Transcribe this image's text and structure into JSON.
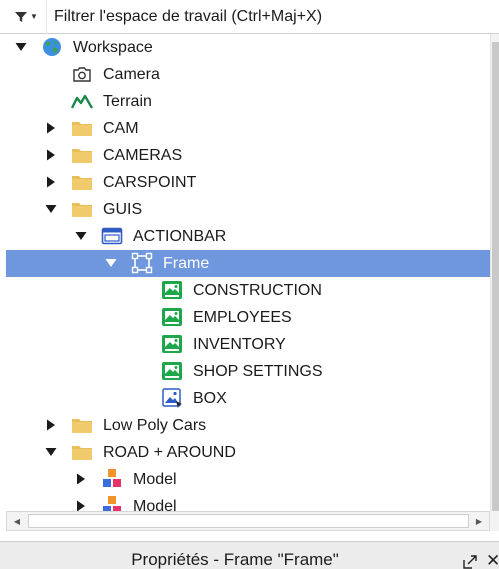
{
  "filter": {
    "icon": "filter-icon",
    "placeholder": "Filtrer l'espace de travail (Ctrl+Maj+X)"
  },
  "tree": [
    {
      "label": "Workspace",
      "icon": "workspace-globe-icon",
      "expanded": true,
      "depth": 0
    },
    {
      "label": "Camera",
      "icon": "camera-icon",
      "depth": 1
    },
    {
      "label": "Terrain",
      "icon": "terrain-icon",
      "depth": 1
    },
    {
      "label": "CAM",
      "icon": "folder-icon",
      "expanded": false,
      "depth": 1
    },
    {
      "label": "CAMERAS",
      "icon": "folder-icon",
      "expanded": false,
      "depth": 1
    },
    {
      "label": "CARSPOINT",
      "icon": "folder-icon",
      "expanded": false,
      "depth": 1
    },
    {
      "label": "GUIS",
      "icon": "folder-icon",
      "expanded": true,
      "depth": 1
    },
    {
      "label": "ACTIONBAR",
      "icon": "screen-gui-icon",
      "expanded": true,
      "depth": 2
    },
    {
      "label": "Frame",
      "icon": "frame-icon",
      "expanded": true,
      "depth": 3,
      "selected": true
    },
    {
      "label": "CONSTRUCTION",
      "icon": "image-button-icon",
      "depth": 4
    },
    {
      "label": "EMPLOYEES",
      "icon": "image-button-icon",
      "depth": 4
    },
    {
      "label": "INVENTORY",
      "icon": "image-button-icon",
      "depth": 4
    },
    {
      "label": "SHOP SETTINGS",
      "icon": "image-button-icon",
      "depth": 4
    },
    {
      "label": "BOX",
      "icon": "image-label-icon",
      "depth": 4
    },
    {
      "label": "Low Poly Cars",
      "icon": "folder-icon",
      "expanded": false,
      "depth": 1
    },
    {
      "label": "ROAD + AROUND",
      "icon": "folder-icon",
      "expanded": true,
      "depth": 1
    },
    {
      "label": "Model",
      "icon": "model-icon",
      "expanded": false,
      "depth": 2
    },
    {
      "label": "Model",
      "icon": "model-icon",
      "expanded": false,
      "depth": 2
    }
  ],
  "properties": {
    "title": "Propriétés - Frame \"Frame\"",
    "undock_icon": "undock-icon",
    "close_glyph": "✕"
  },
  "colors": {
    "selection": "#6f97dd",
    "folder": "#e8bd5a",
    "image_button": "#1ea64a"
  }
}
